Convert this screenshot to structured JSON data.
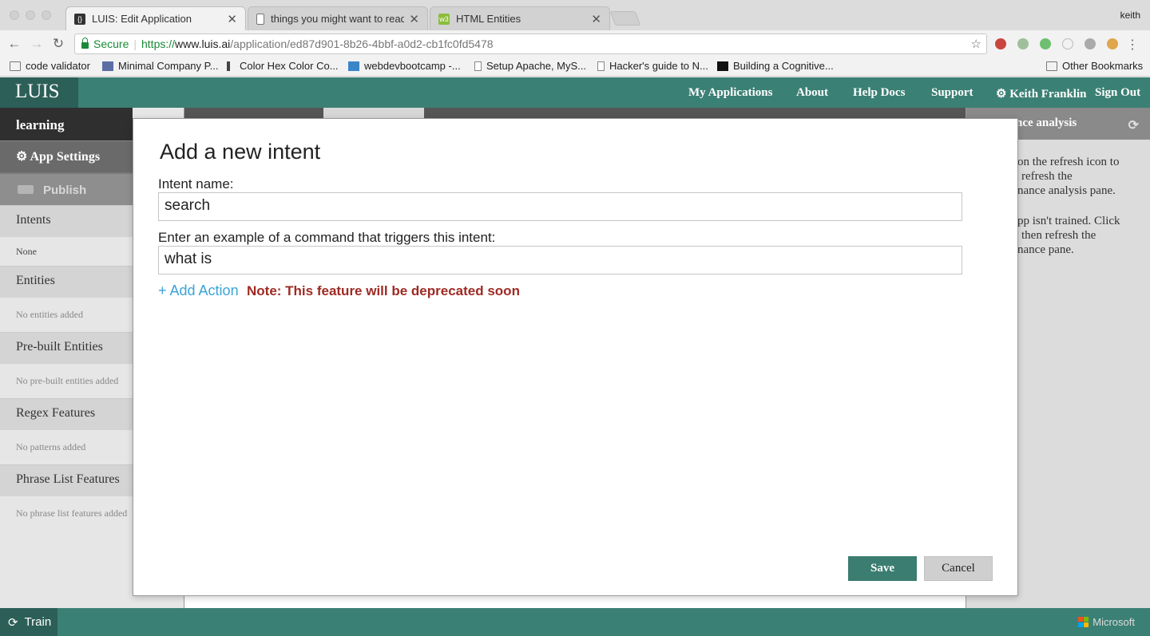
{
  "browser": {
    "tabs": [
      {
        "title": "LUIS: Edit Application",
        "favicon": "luis-favicon"
      },
      {
        "title": "things you might want to read",
        "favicon": "page-icon"
      },
      {
        "title": "HTML Entities",
        "favicon": "w3-icon"
      }
    ],
    "profile": "keith",
    "url": {
      "secure_label": "Secure",
      "scheme": "https://",
      "host": "www.luis.ai",
      "path": "/application/ed87d901-8b26-4bbf-a0d2-cb1fc0fd5478"
    },
    "bookmarks": [
      {
        "label": "code validator",
        "icon": "folder-icon"
      },
      {
        "label": "Minimal Company P...",
        "icon": "site-icon"
      },
      {
        "label": "Color Hex Color Co...",
        "icon": "pin-icon"
      },
      {
        "label": "webdevbootcamp -...",
        "icon": "site-icon"
      },
      {
        "label": "Setup Apache, MyS...",
        "icon": "page-icon"
      },
      {
        "label": "Hacker's guide to N...",
        "icon": "page-icon"
      },
      {
        "label": "Building a Cognitive...",
        "icon": "medium-icon"
      }
    ],
    "other_bookmarks": "Other Bookmarks"
  },
  "luis": {
    "logo": "LUIS",
    "nav": {
      "my_applications": "My Applications",
      "about": "About",
      "help_docs": "Help Docs",
      "support": "Support",
      "user": "Keith Franklin",
      "sign_out": "Sign Out"
    },
    "sidebar": {
      "app_name": "learning",
      "app_settings": "App Settings",
      "publish": "Publish",
      "sections": [
        {
          "title": "Intents",
          "sub": "None"
        },
        {
          "title": "Entities",
          "sub": "No entities added"
        },
        {
          "title": "Pre-built Entities",
          "sub": "No pre-built entities added"
        },
        {
          "title": "Regex Features",
          "sub": "No patterns added"
        },
        {
          "title": "Phrase List Features",
          "sub": "No phrase list features added"
        }
      ]
    },
    "right_panel": {
      "title": "nce analysis",
      "lines": [
        "on the refresh icon to",
        "refresh the",
        "nance analysis pane.",
        "pp isn't trained. Click",
        "then refresh the",
        "nance pane."
      ]
    },
    "bottom": {
      "train": "Train",
      "brand": "Microsoft"
    }
  },
  "modal": {
    "title": "Add a new intent",
    "intent_label": "Intent name:",
    "intent_value": "search",
    "example_label": "Enter an example of a command that triggers this intent:",
    "example_value": "what is",
    "add_action": "+ Add Action",
    "note": "Note: This feature will be deprecated soon",
    "save": "Save",
    "cancel": "Cancel"
  },
  "colors": {
    "brand_teal": "#3b8074",
    "brand_dark": "#2c5f58",
    "link_blue": "#39a3d9",
    "warning_red": "#9e2a23"
  }
}
